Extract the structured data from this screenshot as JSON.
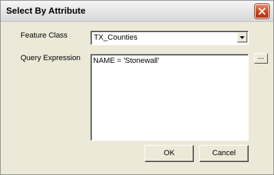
{
  "window": {
    "title": "Select By Attribute"
  },
  "form": {
    "feature_class_label": "Feature Class",
    "feature_class_value": "TX_Counties",
    "query_expression_label": "Query Expression",
    "query_expression_value": "NAME = 'Stonewall'",
    "builder_button_label": "..."
  },
  "buttons": {
    "ok_label": "OK",
    "cancel_label": "Cancel"
  },
  "icons": {
    "close": "close-icon",
    "dropdown": "chevron-down-icon"
  },
  "colors": {
    "close_button": "#c9451f",
    "dialog_background": "#ece9d8"
  }
}
